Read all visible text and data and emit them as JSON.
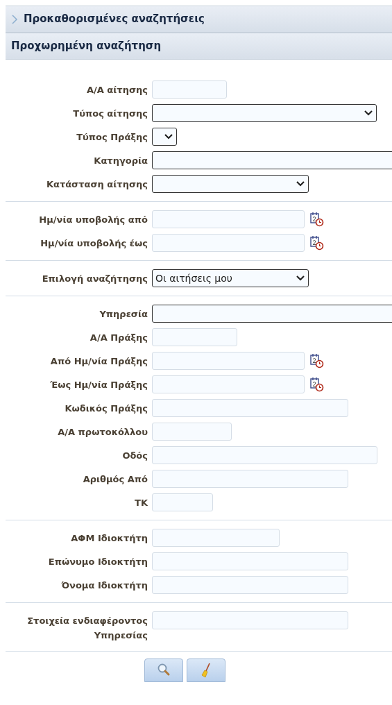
{
  "panels": [
    {
      "title": "Προκαθορισμένες αναζητήσεις",
      "expanded": false
    },
    {
      "title": "Προχωρημένη αναζήτηση",
      "expanded": true
    }
  ],
  "sections": [
    {
      "fields": [
        {
          "label": "Α/Α αίτησης",
          "kind": "text"
        },
        {
          "label": "Τύπος αίτησης",
          "kind": "select"
        },
        {
          "label": "Τύπος Πράξης",
          "kind": "select"
        },
        {
          "label": "Κατηγορία",
          "kind": "lookup"
        },
        {
          "label": "Κατάσταση αίτησης",
          "kind": "select"
        }
      ]
    },
    {
      "fields": [
        {
          "label": "Ημ/νία υποβολής από",
          "kind": "date"
        },
        {
          "label": "Ημ/νία υποβολής έως",
          "kind": "date"
        }
      ]
    },
    {
      "fields": [
        {
          "label": "Επιλογή αναζήτησης",
          "kind": "select",
          "value": "Οι αιτήσεις μου"
        }
      ]
    },
    {
      "fields": [
        {
          "label": "Υπηρεσία",
          "kind": "lookup"
        },
        {
          "label": "Α/Α Πράξης",
          "kind": "text"
        },
        {
          "label": "Από Ημ/νία Πράξης",
          "kind": "date"
        },
        {
          "label": "Έως Ημ/νία Πράξης",
          "kind": "date"
        },
        {
          "label": "Κωδικός Πράξης",
          "kind": "text"
        },
        {
          "label": "Α/Α πρωτοκόλλου",
          "kind": "text"
        },
        {
          "label": "Οδός",
          "kind": "text"
        },
        {
          "label": "Αριθμός Από",
          "kind": "text"
        },
        {
          "label": "ΤΚ",
          "kind": "text"
        }
      ]
    },
    {
      "fields": [
        {
          "label": "ΑΦΜ Ιδιοκτήτη",
          "kind": "text"
        },
        {
          "label": "Επώνυμο Ιδιοκτήτη",
          "kind": "text"
        },
        {
          "label": "Όνομα Ιδιοκτήτη",
          "kind": "text"
        }
      ]
    },
    {
      "fields": [
        {
          "label": "Στοιχεία ενδιαφέροντος Υπηρεσίας",
          "kind": "text"
        }
      ]
    }
  ],
  "buttons": [
    {
      "kind": "search"
    },
    {
      "kind": "clear"
    }
  ]
}
